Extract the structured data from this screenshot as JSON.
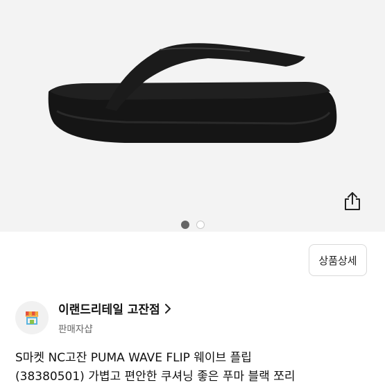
{
  "gallery": {
    "image_alt": "PUMA WAVE FLIP black flip-flop sandal",
    "current_index": 1,
    "total": 2
  },
  "actions": {
    "detail_button_label": "상품상세"
  },
  "seller": {
    "name": "이랜드리테일 고잔점",
    "type": "판매자샵"
  },
  "product": {
    "title_line1": "S마켓 NC고잔 PUMA WAVE FLIP 웨이브 플립",
    "title_line2": "(38380501) 가볍고 편안한 쿠셔닝 좋은 푸마 블랙 쪼리"
  },
  "icons": {
    "share": "share-icon",
    "chevron": "chevron-right-icon",
    "shop": "shop-icon"
  }
}
